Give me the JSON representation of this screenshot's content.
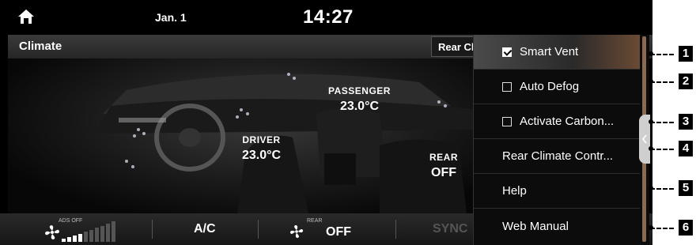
{
  "status_bar": {
    "date": "Jan. 1",
    "time": "14:27"
  },
  "header": {
    "title": "Climate",
    "rear_button": "Rear Climate"
  },
  "zones": {
    "passenger": {
      "label": "PASSENGER",
      "value": "23.0°C"
    },
    "driver": {
      "label": "DRIVER",
      "value": "23.0°C"
    },
    "rear": {
      "label": "REAR",
      "value": "OFF"
    }
  },
  "bottom_bar": {
    "fan_ads_label": "ADS OFF",
    "ac_label": "A/C",
    "rear_fan_label": "REAR",
    "rear_fan_value": "OFF",
    "sync_label": "SYNC"
  },
  "menu": {
    "items": [
      {
        "label": "Smart Vent",
        "checkbox": true,
        "checked": true
      },
      {
        "label": "Auto Defog",
        "checkbox": true,
        "checked": false
      },
      {
        "label": "Activate Carbon...",
        "checkbox": true,
        "checked": false
      },
      {
        "label": "Rear Climate Contr...",
        "checkbox": false
      },
      {
        "label": "Help",
        "checkbox": false
      },
      {
        "label": "Web Manual",
        "checkbox": false
      }
    ]
  },
  "callouts": [
    "1",
    "2",
    "3",
    "4",
    "5",
    "6"
  ],
  "colors": {
    "accent": "#8a6a52",
    "background": "#000000",
    "text": "#ffffff"
  }
}
